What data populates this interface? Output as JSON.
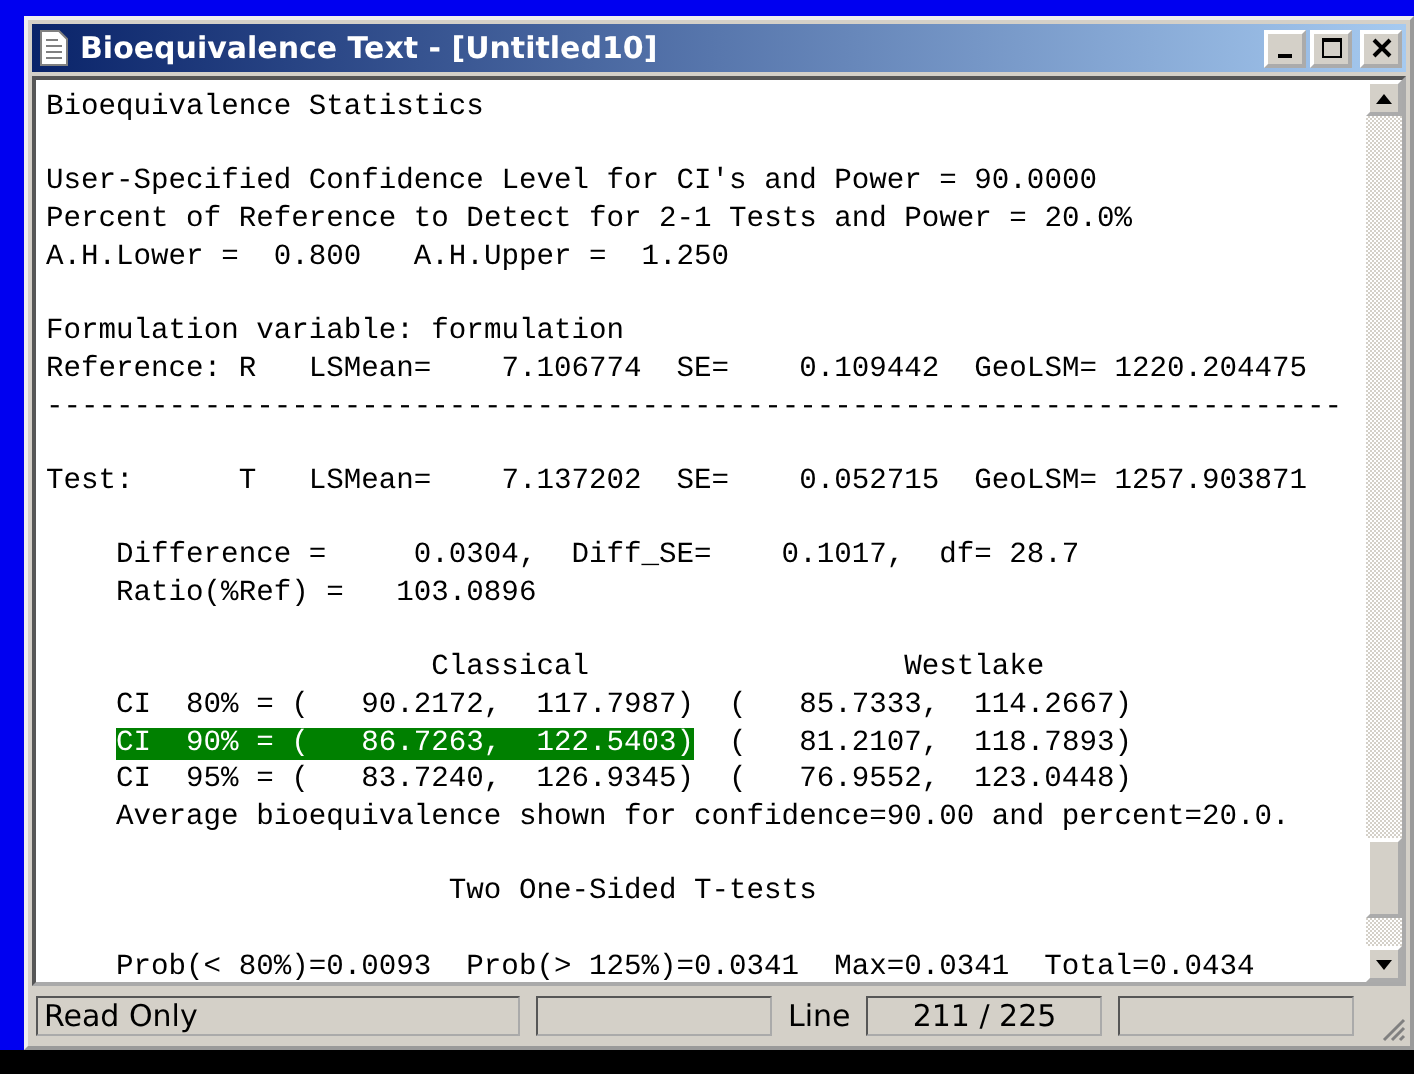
{
  "window": {
    "title": "Bioequivalence Text - [Untitled10]"
  },
  "blocks": [
    [
      {
        "indent": false,
        "spans": [
          {
            "text": "Bioequivalence Statistics",
            "selected": false
          }
        ]
      }
    ],
    [
      {
        "indent": false,
        "spans": [
          {
            "text": "User-Specified Confidence Level for CI's and Power = 90.0000",
            "selected": false
          }
        ]
      },
      {
        "indent": false,
        "spans": [
          {
            "text": "Percent of Reference to Detect for 2-1 Tests and Power = 20.0%",
            "selected": false
          }
        ]
      },
      {
        "indent": false,
        "spans": [
          {
            "text": "A.H.Lower =  0.800   A.H.Upper =  1.250",
            "selected": false
          }
        ]
      }
    ],
    [
      {
        "indent": false,
        "spans": [
          {
            "text": "Formulation variable: formulation",
            "selected": false
          }
        ]
      },
      {
        "indent": false,
        "spans": [
          {
            "text": "Reference: R   LSMean=    7.106774  SE=    0.109442  GeoLSM= 1220.204475",
            "selected": false
          }
        ]
      },
      {
        "indent": false,
        "spans": [
          {
            "text": "--------------------------------------------------------------------------",
            "selected": false
          }
        ]
      }
    ],
    [
      {
        "indent": false,
        "spans": [
          {
            "text": "Test:      T   LSMean=    7.137202  SE=    0.052715  GeoLSM= 1257.903871",
            "selected": false
          }
        ]
      }
    ],
    [
      {
        "indent": true,
        "spans": [
          {
            "text": "Difference =     0.0304,  Diff_SE=    0.1017,  df= 28.7",
            "selected": false
          }
        ]
      },
      {
        "indent": true,
        "spans": [
          {
            "text": "Ratio(%Ref) =   103.0896",
            "selected": false
          }
        ]
      }
    ],
    [
      {
        "indent": true,
        "spans": [
          {
            "text": "                  Classical                  Westlake",
            "selected": false
          }
        ]
      },
      {
        "indent": true,
        "spans": [
          {
            "text": "CI  80% = (   90.2172,  117.7987)  (   85.7333,  114.2667)",
            "selected": false
          }
        ]
      },
      {
        "indent": true,
        "spans": [
          {
            "text": "CI  90% = (   86.7263,  122.5403)",
            "selected": true
          },
          {
            "text": "  (   81.2107,  118.7893)",
            "selected": false
          }
        ]
      },
      {
        "indent": true,
        "spans": [
          {
            "text": "CI  95% = (   83.7240,  126.9345)  (   76.9552,  123.0448)",
            "selected": false
          }
        ]
      },
      {
        "indent": true,
        "spans": [
          {
            "text": "Average bioequivalence shown for confidence=90.00 and percent=20.0.",
            "selected": false
          }
        ]
      }
    ],
    [
      {
        "indent": true,
        "spans": [
          {
            "text": "                   Two One-Sided T-tests",
            "selected": false
          }
        ]
      }
    ],
    [
      {
        "indent": true,
        "spans": [
          {
            "text": "Prob(< 80%)=0.0093  Prob(> 125%)=0.0341  Max=0.0341  Total=0.0434",
            "selected": false
          }
        ]
      }
    ]
  ],
  "status_bar": {
    "mode": "Read Only",
    "line_label": "Line",
    "line_value": "211 / 225"
  }
}
